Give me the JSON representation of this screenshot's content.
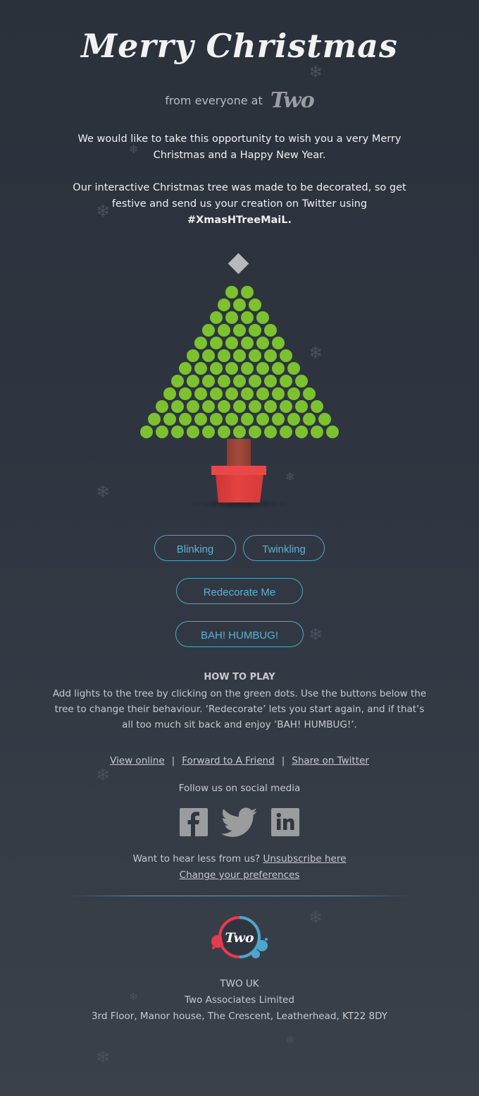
{
  "header": {
    "title": "Merry Christmas",
    "from_text": "from everyone at",
    "brand": "Two"
  },
  "intro": {
    "paragraph1": "We would like to take this opportunity to wish you a very Merry Christmas and a Happy New Year.",
    "paragraph2": "Our interactive Christmas tree was made to be decorated, so get festive and send us your creation on Twitter using",
    "hashtag": "#XmasHTreeMaiL."
  },
  "tree": {
    "row_counts": [
      2,
      3,
      4,
      5,
      6,
      7,
      8,
      9,
      10,
      11,
      12,
      13
    ],
    "colors": {
      "light": "#7cc22e",
      "star": "#b8b9bb",
      "trunk": "#a0483a",
      "pot": "#e0403f",
      "pot_rim": "#e84a47"
    }
  },
  "buttons": {
    "blinking": "Blinking",
    "twinkling": "Twinkling",
    "redecorate": "Redecorate Me",
    "humbug": "BAH! HUMBUG!",
    "color": "#5cb1d8"
  },
  "how_to_play": {
    "title": "HOW TO PLAY",
    "text": "Add lights to the tree by clicking on the green dots. Use the buttons below the tree to change their behaviour. ‘Redecorate’ lets you start again, and if that’s all too much sit back and enjoy ’BAH! HUMBUG!’."
  },
  "footer_links": {
    "view_online": "View online",
    "forward": "Forward to A Friend",
    "share": "Share on Twitter",
    "separator": "|"
  },
  "social": {
    "label": "Follow us on social media",
    "icons": [
      "facebook-icon",
      "twitter-icon",
      "linkedin-icon"
    ]
  },
  "unsubscribe": {
    "prompt": "Want to hear less from us?",
    "link": "Unsubscribe here",
    "preferences": "Change your preferences"
  },
  "company": {
    "logo_text": "Two",
    "name": "TWO UK",
    "legal": "Two Associates Limited",
    "address": "3rd Floor, Manor house, The Crescent, Leatherhead, KT22 8DY"
  }
}
